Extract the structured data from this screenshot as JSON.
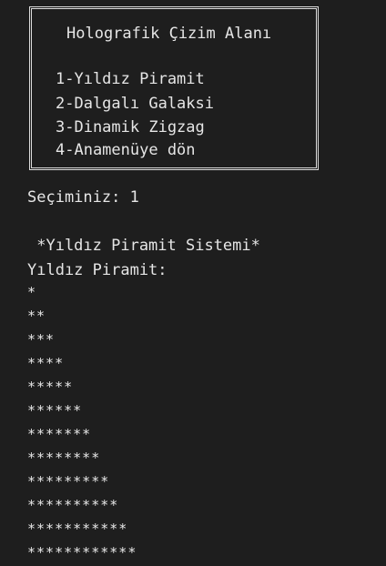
{
  "menu": {
    "title": "Holografik Çizim Alanı",
    "items": [
      "1-Yıldız Piramit",
      "2-Dalgalı Galaksi",
      "3-Dinamik Zigzag",
      "4-Anamenüye dön"
    ]
  },
  "prompt": {
    "label": "Seçiminiz: 1"
  },
  "output": {
    "header": " *Yıldız Piramit Sistemi*",
    "subheader": "Yıldız Piramit:",
    "lines": [
      "*",
      "**",
      "***",
      "****",
      "*****",
      "******",
      "*******",
      "********",
      "*********",
      "**********",
      "***********",
      "************"
    ]
  }
}
